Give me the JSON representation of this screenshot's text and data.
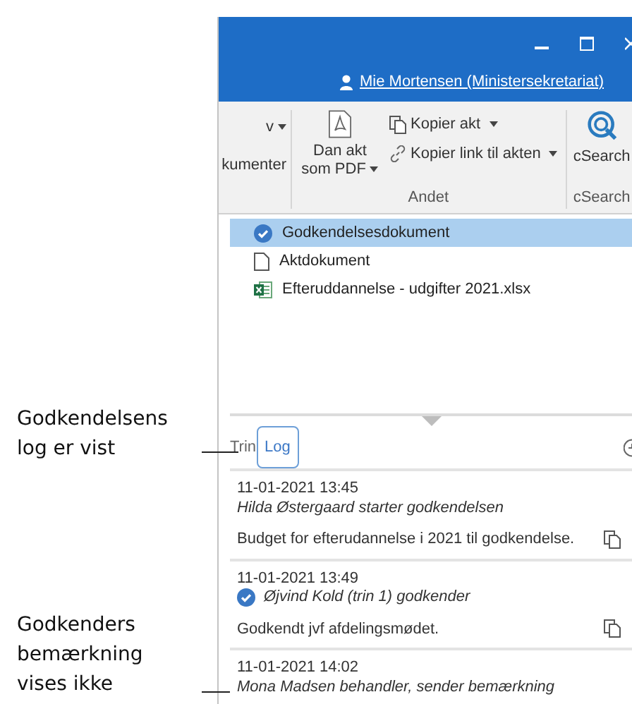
{
  "annotations": [
    {
      "text": "Godkendelsens log er vist"
    },
    {
      "text": "Godkenders bemærkning vises ikke"
    }
  ],
  "title_bar": {
    "buttons": [
      {
        "kind": "minimize"
      },
      {
        "kind": "maximize"
      },
      {
        "kind": "close"
      }
    ],
    "user": "Mie Mortensen (Ministersekretariat)"
  },
  "ribbon": {
    "groups": [
      {
        "kind": "cut",
        "items": [
          {
            "label": "v",
            "dropdown": true
          },
          {
            "label": "kumenter",
            "dropdown": false
          }
        ]
      },
      {
        "kind": "andet",
        "label": "Andet",
        "big": {
          "label": "Dan akt som PDF",
          "dropdown": true
        },
        "items": [
          {
            "label": "Kopier akt",
            "kind": "copy",
            "dropdown": true
          },
          {
            "label": "Kopier link til akten",
            "kind": "link",
            "dropdown": true
          }
        ]
      },
      {
        "kind": "search",
        "label": "cSearch",
        "big": {
          "label": "cSearch",
          "dropdown": false
        }
      }
    ]
  },
  "documents": [
    {
      "name": "Godkendelsesdokument",
      "kind": "approval",
      "selected": true
    },
    {
      "name": "Aktdokument",
      "kind": "document",
      "selected": false
    },
    {
      "name": "Efteruddannelse - udgifter 2021.xlsx",
      "kind": "spreadsheet",
      "selected": false
    }
  ],
  "tabs": [
    {
      "label": "Trin",
      "selected": false
    },
    {
      "label": "Log",
      "selected": true
    }
  ],
  "log": [
    {
      "time": "11-01-2021 13:45",
      "action": "Hilda Østergaard starter godkendelsen",
      "approved": false,
      "comment": "Budget for efterudannelse i 2021 til godkendelse."
    },
    {
      "time": "11-01-2021 13:49",
      "action": "Øjvind Kold (trin 1) godkender",
      "approved": true,
      "comment": "Godkendt jvf afdelingsmødet."
    },
    {
      "time": "11-01-2021 14:02",
      "action": "Mona Madsen behandler, sender bemærkning",
      "approved": false
    }
  ]
}
